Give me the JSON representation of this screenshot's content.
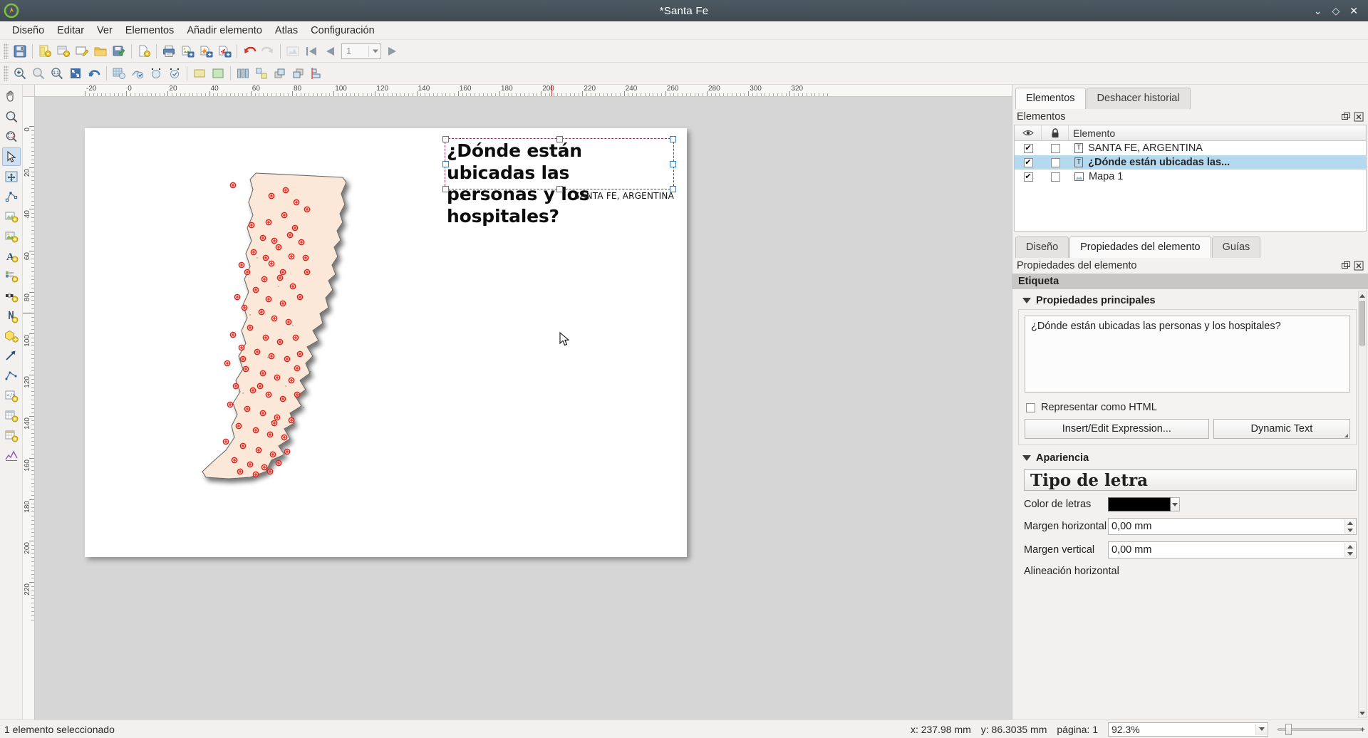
{
  "window": {
    "title": "*Santa Fe",
    "logo_icon": "qgis-logo-icon",
    "minimize_icon": "minimize-icon",
    "maximize_icon": "maximize-icon",
    "close_icon": "close-icon"
  },
  "menubar": {
    "items": [
      {
        "label": "Diseño"
      },
      {
        "label": "Editar"
      },
      {
        "label": "Ver"
      },
      {
        "label": "Elementos"
      },
      {
        "label": "Añadir elemento"
      },
      {
        "label": "Atlas"
      },
      {
        "label": "Configuración"
      }
    ]
  },
  "toolbar_layout": {
    "buttons": [
      {
        "name": "save-project-icon",
        "tip": "Guardar proyecto"
      },
      {
        "name": "new-layout-icon",
        "tip": "Diseño nuevo"
      },
      {
        "name": "duplicate-layout-icon",
        "tip": "Duplicar diseño"
      },
      {
        "name": "layout-manager-icon",
        "tip": "Gestor de diseños"
      },
      {
        "name": "open-folder-icon",
        "tip": "Abrir"
      },
      {
        "name": "save-as-template-icon",
        "tip": "Guardar como plantilla"
      },
      {
        "name": "add-items-from-template-icon",
        "tip": "Añadir elementos desde plantilla"
      },
      {
        "name": "print-icon",
        "tip": "Imprimir"
      },
      {
        "name": "export-image-icon",
        "tip": "Exportar como imagen"
      },
      {
        "name": "export-svg-icon",
        "tip": "Exportar como SVG"
      },
      {
        "name": "export-pdf-icon",
        "tip": "Exportar como PDF"
      },
      {
        "name": "undo-icon",
        "tip": "Deshacer"
      },
      {
        "name": "redo-icon",
        "tip": "Rehacer"
      },
      {
        "name": "atlas-settings-icon",
        "tip": "Configuración del atlas"
      },
      {
        "name": "atlas-first-feature-icon",
        "tip": "Primer objeto"
      },
      {
        "name": "atlas-prev-feature-icon",
        "tip": "Objeto anterior"
      },
      {
        "name": "atlas-next-feature-icon",
        "tip": "Objeto siguiente"
      },
      {
        "name": "atlas-last-feature-icon",
        "tip": "Último objeto"
      }
    ],
    "atlas_page_value": "1"
  },
  "toolbar_nav": {
    "buttons": [
      {
        "name": "pan-layout-icon"
      },
      {
        "name": "zoom-in-icon"
      },
      {
        "name": "zoom-out-icon"
      },
      {
        "name": "zoom-full-icon"
      },
      {
        "name": "refresh-view-icon"
      },
      {
        "name": "show-grid-icon"
      },
      {
        "name": "snap-to-grid-icon"
      },
      {
        "name": "show-guides-icon"
      },
      {
        "name": "snap-to-guides-icon"
      },
      {
        "name": "show-bounding-boxes-icon"
      },
      {
        "name": "show-pages-icon"
      },
      {
        "name": "group-items-icon"
      },
      {
        "name": "ungroup-items-icon"
      },
      {
        "name": "raise-items-icon"
      },
      {
        "name": "lower-items-icon"
      }
    ]
  },
  "left_tools": {
    "buttons": [
      {
        "name": "pan-tool-icon"
      },
      {
        "name": "zoom-tool-icon"
      },
      {
        "name": "select-move-item-icon",
        "active": true
      },
      {
        "name": "move-item-content-icon"
      },
      {
        "name": "edit-nodes-icon"
      },
      {
        "name": "add-map-icon"
      },
      {
        "name": "add-picture-icon"
      },
      {
        "name": "add-label-icon"
      },
      {
        "name": "add-legend-icon"
      },
      {
        "name": "add-scalebar-icon"
      },
      {
        "name": "add-north-arrow-icon"
      },
      {
        "name": "add-shape-icon"
      },
      {
        "name": "add-arrow-icon"
      },
      {
        "name": "add-node-item-icon"
      },
      {
        "name": "add-html-icon"
      },
      {
        "name": "add-attribute-table-icon"
      },
      {
        "name": "add-fixed-table-icon"
      },
      {
        "name": "add-elevation-profile-icon"
      }
    ]
  },
  "ruler": {
    "h_labels": [
      "-20",
      "0",
      "20",
      "40",
      "60",
      "80",
      "100",
      "120",
      "140",
      "160",
      "180",
      "200",
      "220",
      "240",
      "260",
      "280",
      "300",
      "320"
    ],
    "v_labels": [
      "0",
      "20",
      "40",
      "60",
      "80",
      "100",
      "120",
      "140",
      "160",
      "180",
      "200",
      "220"
    ]
  },
  "layout_page": {
    "label_item_text_line1": "¿Dónde están ubicadas las",
    "label_item_text_line2": "personas y los hospitales?",
    "subtitle_item_text": "SANTA FE, ARGENTINA"
  },
  "right_dock": {
    "top_tabs": [
      {
        "label": "Elementos",
        "active": true
      },
      {
        "label": "Deshacer historial",
        "active": false
      }
    ],
    "items_panel_title": "Elementos",
    "items_table": {
      "headers": {
        "visibility": "eye-icon",
        "lock": "lock-icon",
        "name": "Elemento"
      },
      "rows": [
        {
          "visible": "✔",
          "locked": "",
          "type_icon": "T",
          "name": "SANTA FE, ARGENTINA",
          "selected": false
        },
        {
          "visible": "✔",
          "locked": "",
          "type_icon": "T",
          "name": "¿Dónde están ubicadas las...",
          "selected": true
        },
        {
          "visible": "✔",
          "locked": "",
          "type_icon": "M",
          "name": "Mapa 1",
          "selected": false
        }
      ]
    },
    "bottom_tabs": [
      {
        "label": "Diseño",
        "active": false
      },
      {
        "label": "Propiedades del elemento",
        "active": true
      },
      {
        "label": "Guías",
        "active": false
      }
    ],
    "properties_panel_title": "Propiedades del elemento",
    "section_title": "Etiqueta",
    "groups": {
      "main": {
        "title": "Propiedades principales",
        "textarea_value": "¿Dónde están ubicadas las personas y los hospitales?",
        "render_as_html_label": "Representar como HTML",
        "insert_expression_label": "Insert/Edit Expression...",
        "dynamic_text_label": "Dynamic Text"
      },
      "appearance": {
        "title": "Apariencia",
        "font_button_label": "Tipo de letra",
        "font_color_label": "Color de letras",
        "font_color_value": "#000000",
        "h_margin_label": "Margen horizontal",
        "h_margin_value": "0,00 mm",
        "v_margin_label": "Margen vertical",
        "v_margin_value": "0,00 mm",
        "h_align_label": "Alineación horizontal"
      }
    },
    "dock_float_icon": "undock-icon",
    "dock_close_icon": "close-icon"
  },
  "statusbar": {
    "selection_text": "1 elemento seleccionado",
    "x_text": "x: 237.98 mm",
    "y_text": "y: 86.3035 mm",
    "page_text": "página: 1",
    "zoom_value": "92.3%",
    "zoom_minus": "−",
    "zoom_plus": "+"
  },
  "colors": {
    "titlebar": "#45515a",
    "selection_highlight": "#b5d9ee",
    "item_outline": "#8a2f5d",
    "handle_border": "#3f7fb5",
    "map_fill": "#fbe8d8",
    "map_point": "#e2231a",
    "ruler_cursor": "#d03a3a"
  }
}
